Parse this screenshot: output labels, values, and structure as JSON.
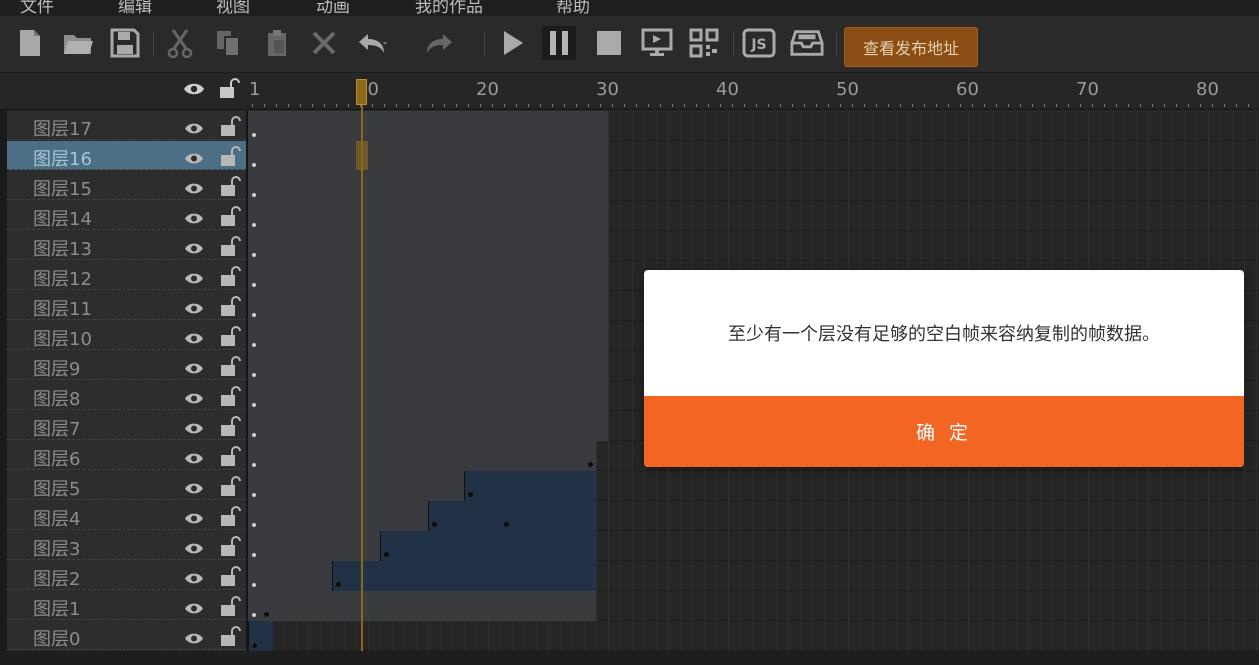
{
  "menu": [
    "文件",
    "编辑",
    "视图",
    "动画",
    "我的作品",
    "帮助"
  ],
  "toolbar": {
    "icons": [
      "new-file-icon",
      "open-folder-icon",
      "save-icon",
      "cut-icon",
      "copy-icon",
      "paste-icon",
      "delete-icon",
      "undo-icon",
      "redo-icon",
      "play-icon",
      "pause-icon",
      "stop-icon",
      "preview-icon",
      "qrcode-icon",
      "js-icon",
      "export-icon"
    ],
    "publish_label": "查看发布地址",
    "accent": "#8a4d13"
  },
  "ruler": {
    "labels": [
      "1",
      "10",
      "20",
      "30",
      "40",
      "50",
      "60",
      "70",
      "80"
    ],
    "current_frame": 10
  },
  "layers": [
    "图层17",
    "图层16",
    "图层15",
    "图层14",
    "图层13",
    "图层12",
    "图层11",
    "图层10",
    "图层9",
    "图层8",
    "图层7",
    "图层6",
    "图层5",
    "图层4",
    "图层3",
    "图层2",
    "图层1",
    "图层0"
  ],
  "selected_layer": "图层16",
  "dialog": {
    "message": "至少有一个层没有足够的空白帧来容纳复制的帧数据。",
    "ok_label": "确 定",
    "button_color": "#f26522"
  }
}
